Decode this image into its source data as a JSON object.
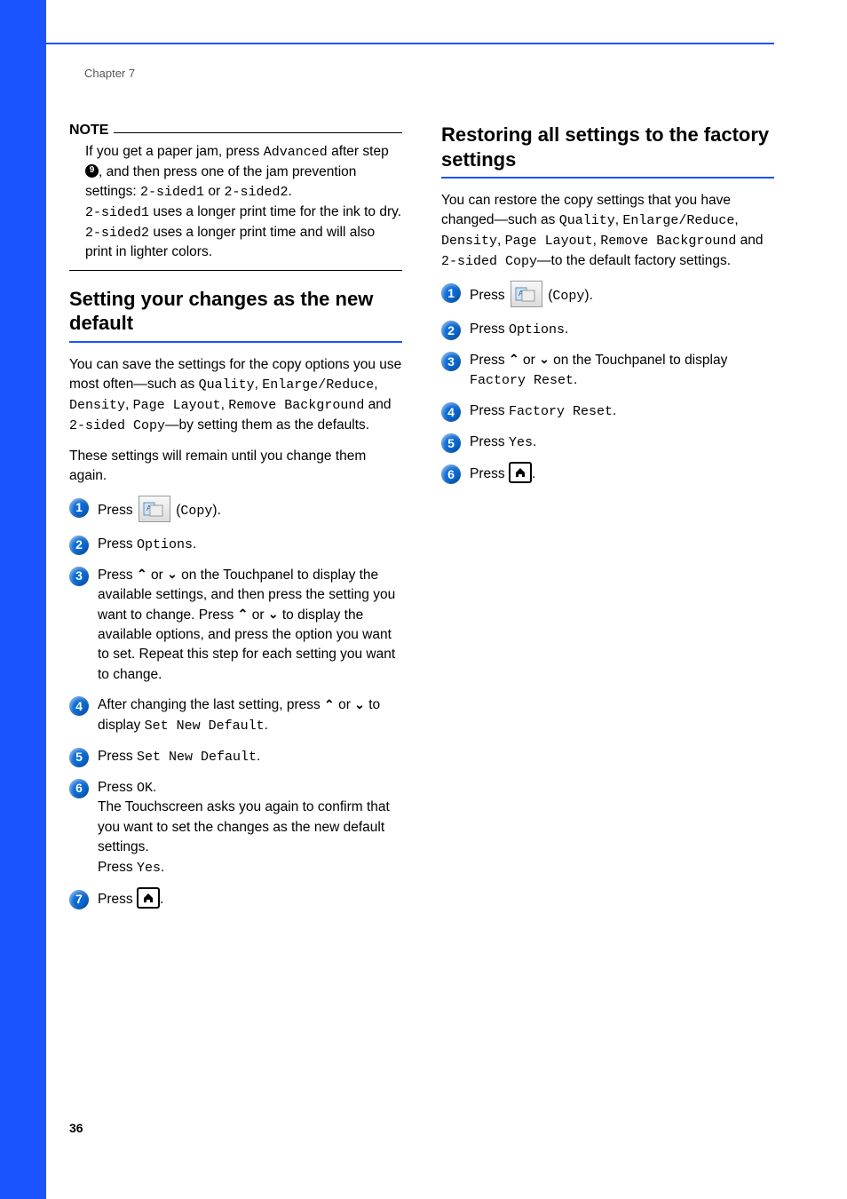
{
  "chapter": "Chapter 7",
  "page_number": "36",
  "note": {
    "label": "NOTE",
    "line1a": "If you get a paper jam, press ",
    "line1_mono": "Advanced",
    "line2a": "after step ",
    "line2_ref": "9",
    "line2b": ", and then press one of the jam prevention settings: ",
    "line2_mono1": "2-sided1",
    "line2c": " or ",
    "line2_mono2": "2-sided2",
    "line2d": ".",
    "line3_mono": "2-sided1",
    "line3": " uses a longer print time for the ink to dry.",
    "line4_mono": "2-sided2",
    "line4": " uses a longer print time and will also print in lighter colors."
  },
  "left": {
    "heading": "Setting your changes as the new default",
    "intro1a": "You can save the settings for the copy options you use most often—such as ",
    "intro1_m1": "Quality",
    "intro1b": ", ",
    "intro1_m2": "Enlarge/Reduce",
    "intro1c": ", ",
    "intro1_m3": "Density",
    "intro1d": ", ",
    "intro1_m4": "Page Layout",
    "intro1e": ", ",
    "intro1_m5": "Remove Background",
    "intro1f": " and ",
    "intro1_m6": "2-sided Copy",
    "intro1g": "—by setting them as the defaults.",
    "intro2": "These settings will remain until you change them again.",
    "s1a": "Press ",
    "s1b": " (",
    "s1_mono": "Copy",
    "s1c": ").",
    "s2a": "Press ",
    "s2_mono": "Options",
    "s2b": ".",
    "s3a": "Press ",
    "s3b": " or ",
    "s3c": " on the Touchpanel to display the available settings, and then press the setting you want to change. Press ",
    "s3d": " or ",
    "s3e": " to display the available options, and press the option you want to set. Repeat this step for each setting you want to change.",
    "s4a": "After changing the last setting, press ",
    "s4b": " or ",
    "s4c": " to display ",
    "s4_mono": "Set New Default",
    "s4d": ".",
    "s5a": "Press ",
    "s5_mono": "Set New Default",
    "s5b": ".",
    "s6a": "Press ",
    "s6_mono1": "OK",
    "s6b": ".",
    "s6c": "The Touchscreen asks you again to confirm that you want to set the changes as the new default settings.",
    "s6d": "Press ",
    "s6_mono2": "Yes",
    "s6e": ".",
    "s7a": "Press ",
    "s7b": "."
  },
  "right": {
    "heading": "Restoring all settings to the factory settings",
    "intro_a": "You can restore the copy settings that you have changed—such as ",
    "intro_m1": "Quality",
    "intro_b": ", ",
    "intro_m2": "Enlarge/Reduce",
    "intro_c": ", ",
    "intro_m3": "Density",
    "intro_d": ", ",
    "intro_m4": "Page Layout",
    "intro_e": ", ",
    "intro_m5": "Remove Background",
    "intro_f": " and ",
    "intro_m6": "2-sided Copy",
    "intro_g": "—to the default factory settings.",
    "s1a": "Press ",
    "s1b": " (",
    "s1_mono": "Copy",
    "s1c": ").",
    "s2a": "Press ",
    "s2_mono": "Options",
    "s2b": ".",
    "s3a": "Press ",
    "s3b": " or ",
    "s3c": " on the Touchpanel to display ",
    "s3_mono": "Factory Reset",
    "s3d": ".",
    "s4a": "Press ",
    "s4_mono": "Factory Reset",
    "s4b": ".",
    "s5a": "Press ",
    "s5_mono": "Yes",
    "s5b": ".",
    "s6a": "Press ",
    "s6b": "."
  }
}
